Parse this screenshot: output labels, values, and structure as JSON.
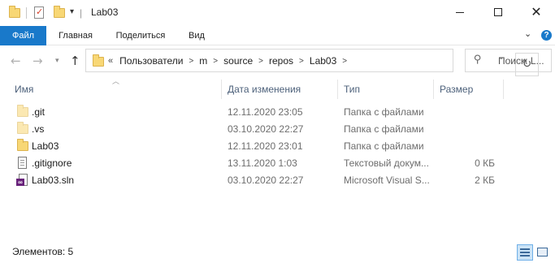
{
  "window": {
    "title": "Lab03",
    "buttons": {
      "minimize": "minimize",
      "maximize": "maximize",
      "close": "close"
    }
  },
  "ribbon": {
    "tabs": [
      {
        "label": "Файл"
      },
      {
        "label": "Главная"
      },
      {
        "label": "Поделиться"
      },
      {
        "label": "Вид"
      }
    ],
    "accent_color": "#1979ca"
  },
  "navigation": {
    "path_prefix": "«",
    "breadcrumbs": [
      "Пользователи",
      "m",
      "source",
      "repos",
      "Lab03"
    ],
    "search_placeholder": "Поиск: L..."
  },
  "list": {
    "columns": {
      "name": "Имя",
      "date": "Дата изменения",
      "type": "Тип",
      "size": "Размер"
    },
    "rows": [
      {
        "icon": "folder-icon",
        "name": ".git",
        "date": "12.11.2020 23:05",
        "type": "Папка с файлами",
        "size": ""
      },
      {
        "icon": "folder-icon",
        "name": ".vs",
        "date": "03.10.2020 22:27",
        "type": "Папка с файлами",
        "size": ""
      },
      {
        "icon": "folder-icon",
        "name": "Lab03",
        "date": "12.11.2020 23:01",
        "type": "Папка с файлами",
        "size": ""
      },
      {
        "icon": "text-file-icon",
        "name": ".gitignore",
        "date": "13.11.2020 1:03",
        "type": "Текстовый докум...",
        "size": "0 КБ"
      },
      {
        "icon": "vs-solution-icon",
        "name": "Lab03.sln",
        "date": "03.10.2020 22:27",
        "type": "Microsoft Visual S...",
        "size": "2 КБ"
      }
    ]
  },
  "status": {
    "items_count": "Элементов: 5"
  }
}
